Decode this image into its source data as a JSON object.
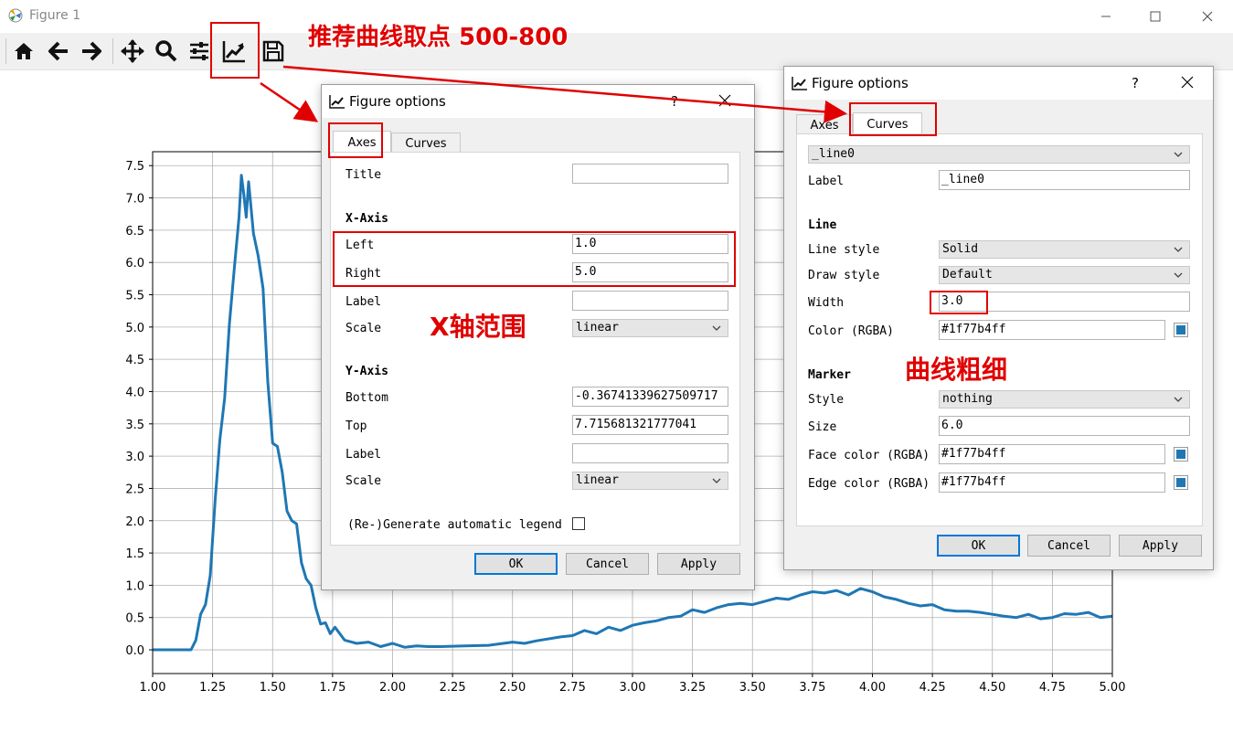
{
  "window": {
    "title": "Figure 1"
  },
  "toolbar": {
    "icons": [
      "home-icon",
      "back-icon",
      "forward-icon",
      "pan-icon",
      "zoom-icon",
      "subplots-icon",
      "figure-options-icon",
      "save-icon"
    ]
  },
  "annotations": {
    "top": "推荐曲线取点 500-800",
    "xaxis": "X轴范围",
    "width": "曲线粗细"
  },
  "dialog_axes": {
    "title": "Figure options",
    "help": "?",
    "tabs": [
      "Axes",
      "Curves"
    ],
    "active_tab": "Axes",
    "title_label": "Title",
    "title_value": "",
    "xaxis": {
      "header": "X-Axis",
      "left_label": "Left",
      "left_value": "1.0",
      "right_label": "Right",
      "right_value": "5.0",
      "label_label": "Label",
      "label_value": "",
      "scale_label": "Scale",
      "scale_value": "linear"
    },
    "yaxis": {
      "header": "Y-Axis",
      "bottom_label": "Bottom",
      "bottom_value": "-0.36741339627509717",
      "top_label": "Top",
      "top_value": "7.715681321777041",
      "label_label": "Label",
      "label_value": "",
      "scale_label": "Scale",
      "scale_value": "linear"
    },
    "legend_label": "(Re-)Generate automatic legend",
    "buttons": {
      "ok": "OK",
      "cancel": "Cancel",
      "apply": "Apply"
    }
  },
  "dialog_curves": {
    "title": "Figure options",
    "help": "?",
    "tabs": [
      "Axes",
      "Curves"
    ],
    "active_tab": "Curves",
    "curve_select": "_line0",
    "label_label": "Label",
    "label_value": "_line0",
    "line": {
      "header": "Line",
      "style_label": "Line style",
      "style_value": "Solid",
      "draw_label": "Draw style",
      "draw_value": "Default",
      "width_label": "Width",
      "width_value": "3.0",
      "color_label": "Color (RGBA)",
      "color_value": "#1f77b4ff"
    },
    "marker": {
      "header": "Marker",
      "style_label": "Style",
      "style_value": "nothing",
      "size_label": "Size",
      "size_value": "6.0",
      "face_label": "Face color (RGBA)",
      "face_value": "#1f77b4ff",
      "edge_label": "Edge color (RGBA)",
      "edge_value": "#1f77b4ff"
    },
    "buttons": {
      "ok": "OK",
      "cancel": "Cancel",
      "apply": "Apply"
    }
  },
  "colors": {
    "line": "#1f77b4",
    "annotation": "#e00000",
    "accent": "#0078d7"
  },
  "chart_data": {
    "type": "line",
    "title": "",
    "xlabel": "",
    "ylabel": "",
    "xlim": [
      1.0,
      5.0
    ],
    "ylim": [
      -0.36741339627509717,
      7.715681321777041
    ],
    "grid": true,
    "xticks": [
      "1.00",
      "1.25",
      "1.50",
      "1.75",
      "2.00",
      "2.25",
      "2.50",
      "2.75",
      "3.00",
      "3.25",
      "3.50",
      "3.75",
      "4.00",
      "4.25",
      "4.50",
      "4.75",
      "5.00"
    ],
    "yticks": [
      "0.0",
      "0.5",
      "1.0",
      "1.5",
      "2.0",
      "2.5",
      "3.0",
      "3.5",
      "4.0",
      "4.5",
      "5.0",
      "5.5",
      "6.0",
      "6.5",
      "7.0",
      "7.5"
    ],
    "series": [
      {
        "color": "#1f77b4",
        "x": [
          1.0,
          1.05,
          1.1,
          1.16,
          1.18,
          1.2,
          1.22,
          1.24,
          1.26,
          1.28,
          1.3,
          1.32,
          1.34,
          1.36,
          1.37,
          1.38,
          1.39,
          1.4,
          1.42,
          1.44,
          1.46,
          1.48,
          1.5,
          1.52,
          1.54,
          1.56,
          1.58,
          1.6,
          1.62,
          1.64,
          1.66,
          1.68,
          1.7,
          1.72,
          1.74,
          1.76,
          1.8,
          1.85,
          1.9,
          1.95,
          2.0,
          2.05,
          2.1,
          2.15,
          2.2,
          2.3,
          2.4,
          2.5,
          2.55,
          2.6,
          2.7,
          2.75,
          2.8,
          2.85,
          2.9,
          2.95,
          3.0,
          3.05,
          3.1,
          3.15,
          3.2,
          3.25,
          3.3,
          3.35,
          3.4,
          3.45,
          3.5,
          3.55,
          3.6,
          3.65,
          3.7,
          3.75,
          3.8,
          3.85,
          3.9,
          3.95,
          4.0,
          4.05,
          4.1,
          4.15,
          4.2,
          4.25,
          4.3,
          4.35,
          4.4,
          4.45,
          4.5,
          4.55,
          4.6,
          4.65,
          4.7,
          4.75,
          4.8,
          4.85,
          4.9,
          4.95,
          5.0
        ],
        "y": [
          0.0,
          0.0,
          0.0,
          0.0,
          0.15,
          0.55,
          0.7,
          1.15,
          2.3,
          3.25,
          3.9,
          5.05,
          5.9,
          6.7,
          7.35,
          7.05,
          6.7,
          7.25,
          6.45,
          6.1,
          5.6,
          4.15,
          3.2,
          3.15,
          2.75,
          2.15,
          2.0,
          1.95,
          1.35,
          1.1,
          1.0,
          0.65,
          0.4,
          0.42,
          0.25,
          0.35,
          0.15,
          0.1,
          0.12,
          0.05,
          0.1,
          0.04,
          0.06,
          0.05,
          0.05,
          0.06,
          0.07,
          0.12,
          0.1,
          0.14,
          0.2,
          0.22,
          0.3,
          0.25,
          0.35,
          0.3,
          0.38,
          0.42,
          0.45,
          0.5,
          0.52,
          0.62,
          0.58,
          0.65,
          0.7,
          0.72,
          0.7,
          0.75,
          0.8,
          0.78,
          0.85,
          0.9,
          0.88,
          0.92,
          0.85,
          0.95,
          0.9,
          0.82,
          0.78,
          0.72,
          0.68,
          0.7,
          0.62,
          0.6,
          0.6,
          0.58,
          0.55,
          0.52,
          0.5,
          0.55,
          0.48,
          0.5,
          0.56,
          0.55,
          0.58,
          0.5,
          0.52
        ]
      }
    ]
  }
}
